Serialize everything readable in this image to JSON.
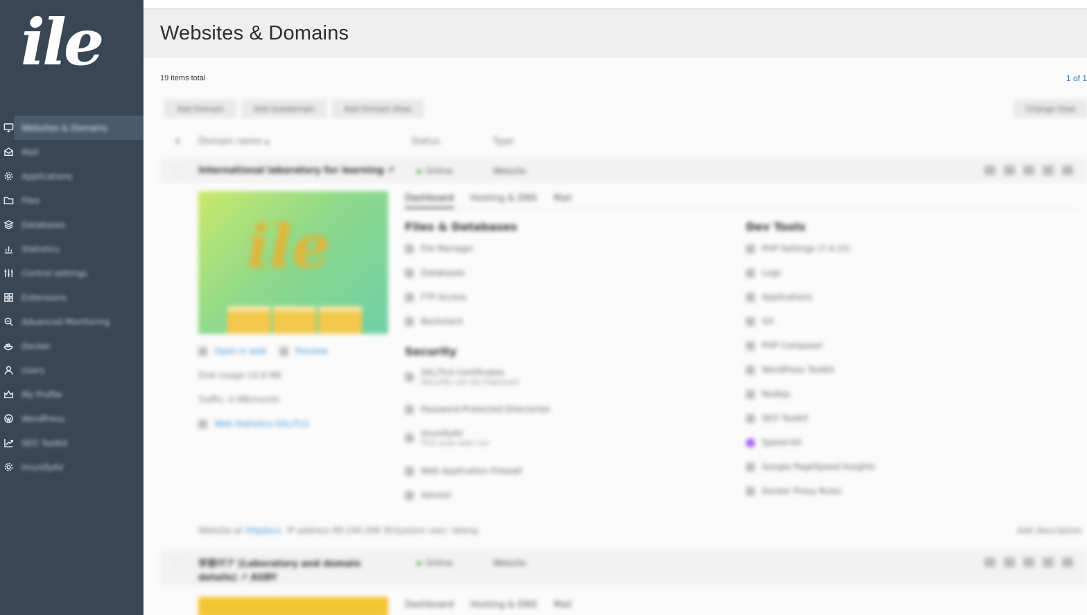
{
  "sidebar": {
    "logo": "ile",
    "items": [
      {
        "label": "Websites & Domains",
        "icon": "monitor-icon",
        "active": true
      },
      {
        "label": "Mail",
        "icon": "mail-icon"
      },
      {
        "label": "Applications",
        "icon": "gear-icon"
      },
      {
        "label": "Files",
        "icon": "folder-icon"
      },
      {
        "label": "Databases",
        "icon": "layers-icon"
      },
      {
        "label": "Statistics",
        "icon": "bar-chart-icon"
      },
      {
        "label": "Control settings",
        "icon": "sliders-icon"
      },
      {
        "label": "Extensions",
        "icon": "grid-icon"
      },
      {
        "label": "Advanced Monitoring",
        "icon": "magnifier-icon"
      },
      {
        "label": "Docker",
        "icon": "whale-icon"
      },
      {
        "label": "Users",
        "icon": "user-icon"
      },
      {
        "label": "My Profile",
        "icon": "profile-icon"
      },
      {
        "label": "WordPress",
        "icon": "wordpress-icon"
      },
      {
        "label": "SEO Toolkit",
        "icon": "trend-icon"
      },
      {
        "label": "ImunifyAV",
        "icon": "gear-icon"
      }
    ]
  },
  "header": {
    "title": "Websites & Domains"
  },
  "list": {
    "items_total": "19 items total",
    "pager": "1 of 1"
  },
  "toolbar": {
    "add_domain": "Add Domain",
    "add_subdomain": "Add Subdomain",
    "add_domain_alias": "Add Domain Alias",
    "change_view": "Change View"
  },
  "columns": {
    "domain": "Domain name ▴",
    "status": "Status",
    "type": "Type"
  },
  "domains": [
    {
      "name": "International laboratory for learning ↗",
      "status": "Online",
      "type": "Website",
      "tabs": [
        "Dashboard",
        "Hosting & DNS",
        "Mail"
      ],
      "files_title": "Files & Databases",
      "files": [
        "File Manager",
        "Databases",
        "FTP Access",
        "Backstack"
      ],
      "security_title": "Security",
      "security": [
        {
          "label": "SSL/TLS Certificates",
          "sub": "Security can be improved"
        },
        {
          "label": "Password-Protected Directories",
          "sub": ""
        },
        {
          "label": "ImunifyAV",
          "sub": "This scan was run"
        },
        {
          "label": "Web Application Firewall",
          "sub": ""
        },
        {
          "label": "Advisor",
          "sub": ""
        }
      ],
      "dev_title": "Dev Tools",
      "dev": [
        "PHP Settings (7.4.15)",
        "Logs",
        "Applications",
        "Git",
        "PHP Composer",
        "WordPress Toolkit",
        "Nodejs",
        "SEO Toolkit",
        "Speed Kit",
        "Google PageSpeed Insights",
        "Docker Proxy Rules"
      ],
      "open_web": "Open in web",
      "preview": "Preview",
      "disk_usage": "Disk Usage 19.8 MB",
      "traffic": "Traffic: 0 MB/month",
      "web_stats": "Web Statistics SSL/TLS",
      "footer_website": "Website at",
      "footer_host": "httpdocs",
      "footer_ip": "IP address 89.249.208.30",
      "footer_user": "System user: lateng",
      "footer_desc": "Add description"
    },
    {
      "name": "学習ITア (Laboratory and domain details) ↗ ASBY",
      "status": "Online",
      "type": "Website",
      "tabs": [
        "Dashboard",
        "Hosting & DNS",
        "Mail"
      ]
    }
  ]
}
